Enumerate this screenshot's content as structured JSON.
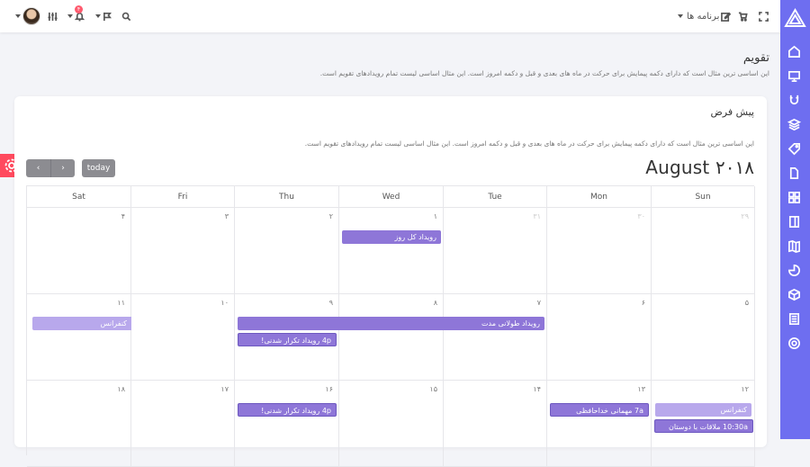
{
  "topbar": {
    "apps_label": "برنامه ها",
    "notification_count": "۴"
  },
  "page": {
    "title": "تقویم",
    "description": "این اساسی ترین مثال است که دارای دکمه پیمایش برای حرکت در ماه های بعدی و قبل و دکمه امروز است. این مثال اساسی لیست تمام رویدادهای تقویم است."
  },
  "card": {
    "title": "پیش فرض",
    "description": "این اساسی ترین مثال است که دارای دکمه پیمایش برای حرکت در ماه های بعدی و قبل و دکمه امروز است. این مثال اساسی لیست تمام رویدادهای تقویم است."
  },
  "calendar": {
    "title": "August ۲۰۱۸",
    "today_label": "today",
    "prev_label": "‹",
    "next_label": "›",
    "weekdays": [
      "Sun",
      "Mon",
      "Tue",
      "Wed",
      "Thu",
      "Fri",
      "Sat"
    ],
    "weeks": [
      [
        "۲۹",
        "۳۰",
        "۳۱",
        "۱",
        "۲",
        "۳",
        "۴"
      ],
      [
        "۵",
        "۶",
        "۷",
        "۸",
        "۹",
        "۱۰",
        "۱۱"
      ],
      [
        "۱۲",
        "۱۳",
        "۱۴",
        "۱۵",
        "۱۶",
        "۱۷",
        "۱۸"
      ]
    ],
    "events": {
      "all_day": "رویداد کل روز",
      "conference1": "کنفرانس",
      "long_event": "رویداد طولانی مدت",
      "repeat1": "4p رویداد تکرار شدنی!",
      "conference2": "کنفرانس",
      "farewell": "7a مهمانی خداحافظی",
      "meeting": "10:30a ملاقات با دوستان",
      "repeat2": "4p رویداد تکرار شدنی!"
    }
  },
  "colors": {
    "sidebar": "#6e6ef0",
    "event": "#8e76d8",
    "event_light": "#b8a8ec",
    "settings": "#ff4a5e"
  }
}
